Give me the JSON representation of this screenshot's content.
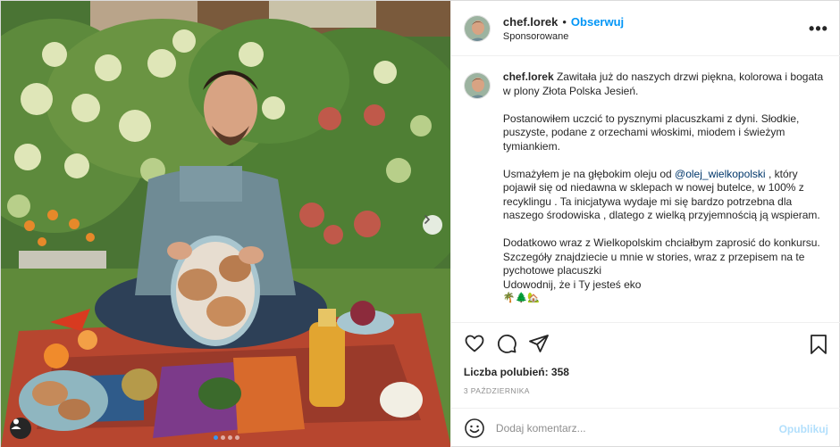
{
  "post": {
    "username": "chef.lorek",
    "follow_label": "Obserwuj",
    "sponsored_label": "Sponsorowane",
    "more_label": "•••",
    "separator": "•"
  },
  "caption": {
    "username": "chef.lorek",
    "p1": "Zawitała już do naszych drzwi piękna, kolorowa i bogata w plony Złota Polska Jesień.",
    "p2": "Postanowiłem uczcić to pysznymi placuszkami z dyni. Słodkie, puszyste, podane z orzechami włoskimi, miodem i świeżym tymiankiem.",
    "p3_before": "Usmażyłem je na głębokim oleju od",
    "p3_mention": "@olej_wielkopolski",
    "p3_after": ", który pojawił się od niedawna w sklepach w nowej butelce, w 100% z recyklingu . Ta inicjatywa wydaje mi się bardzo potrzebna dla naszego środowiska , dlatego z wielką przyjemnością ją wspieram.",
    "p4": "Dodatkowo wraz z Wielkopolskim chciałbym zaprosić do konkursu. Szczegóły znajdziecie u mnie w stories, wraz z przepisem na te pychotowe placuszki",
    "p5": "Udowodnij, że i Ty jesteś eko",
    "emoji": "🌴🌲🏡"
  },
  "actions": {
    "like_icon": "heart-icon",
    "comment_icon": "comment-icon",
    "share_icon": "share-icon",
    "save_icon": "bookmark-icon"
  },
  "likes_text": "Liczba polubień: 358",
  "date_text": "3 PAŹDZIERNIKA",
  "comment_box": {
    "placeholder": "Dodaj komentarz...",
    "publish_label": "Opublikuj"
  },
  "carousel": {
    "slide_count": 4,
    "active_index": 0
  },
  "colors": {
    "accent": "#0095f6",
    "publish_disabled": "#b2dffc",
    "carousel_active": "#3897f0"
  }
}
